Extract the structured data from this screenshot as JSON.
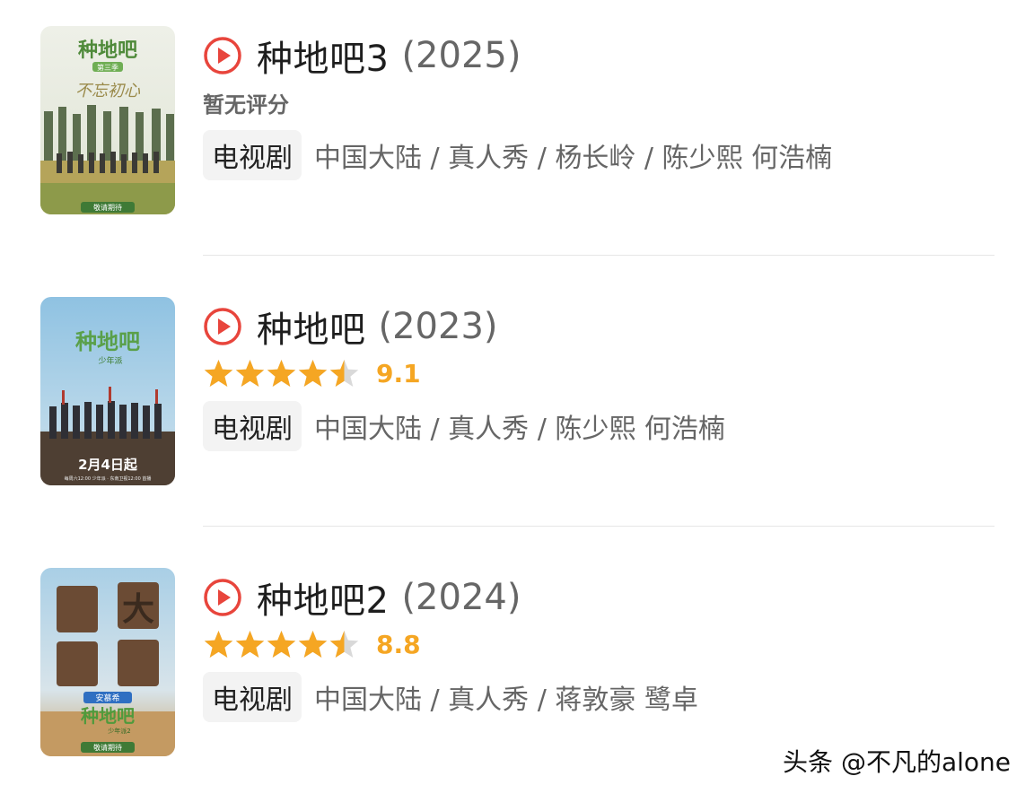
{
  "results": [
    {
      "title": "种地吧3",
      "year": "(2025)",
      "rating_text": "暂无评分",
      "rated": false,
      "tag": "电视剧",
      "meta": "中国大陆 / 真人秀 / 杨长岭 / 陈少熙 何浩楠",
      "poster": {
        "logo": "种地吧",
        "subtitle": "第三季",
        "tagline": "不忘初心",
        "bottom_text": "敬请期待"
      }
    },
    {
      "title": "种地吧",
      "year": "(2023)",
      "rated": true,
      "stars": 4.5,
      "score": "9.1",
      "tag": "电视剧",
      "meta": "中国大陆 / 真人秀 / 陈少熙 何浩楠",
      "poster": {
        "logo": "种地吧",
        "subtitle": "少年派",
        "bottom_text": "2月4日起",
        "fine_print": "每周六12:00 少年派 · 东南卫视12:00 首播"
      }
    },
    {
      "title": "种地吧2",
      "year": "(2024)",
      "rated": true,
      "stars": 4.5,
      "score": "8.8",
      "tag": "电视剧",
      "meta": "中国大陆 / 真人秀 / 蒋敦豪 鹭卓",
      "poster": {
        "logo": "种地吧",
        "subtitle": "少年派2",
        "big_text": "大",
        "sponsor": "安慕希",
        "bottom_text": "敬请期待"
      }
    }
  ],
  "watermark": "头条 @不凡的alone",
  "colors": {
    "play": "#e8453c",
    "star": "#f5a623",
    "star_empty": "#d9d9d9"
  }
}
